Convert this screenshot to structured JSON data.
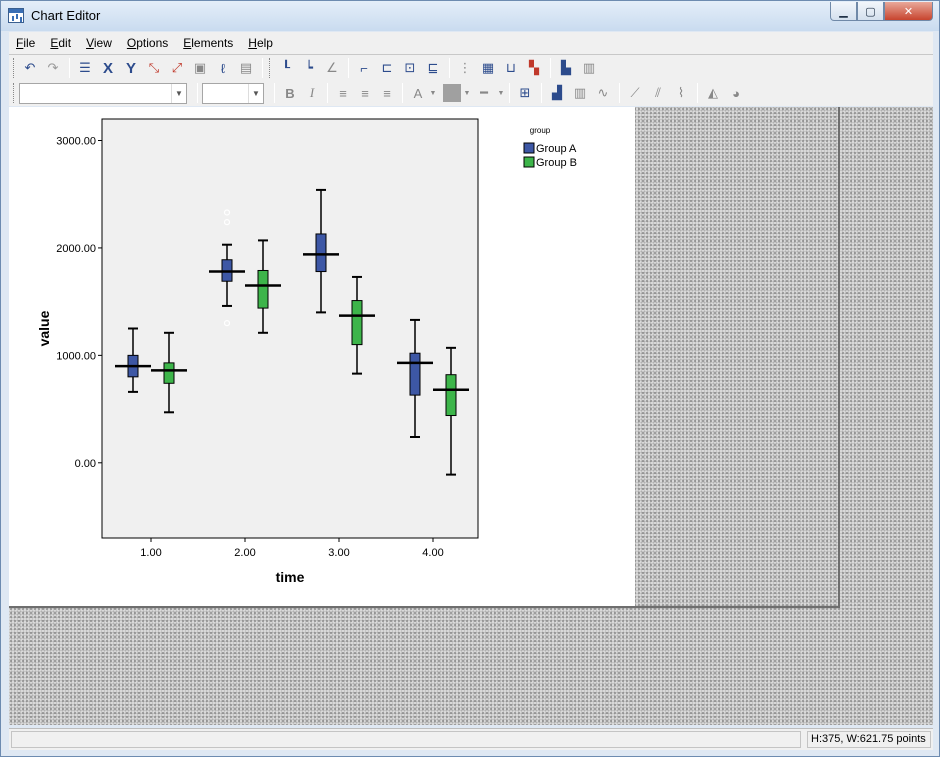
{
  "window": {
    "title": "Chart Editor",
    "title_icon": "chart-editor-app-icon"
  },
  "menu": [
    {
      "label": "File",
      "u": "F",
      "rest": "ile"
    },
    {
      "label": "Edit",
      "u": "E",
      "rest": "dit"
    },
    {
      "label": "View",
      "u": "V",
      "rest": "iew"
    },
    {
      "label": "Options",
      "u": "O",
      "rest": "ptions"
    },
    {
      "label": "Elements",
      "u": "E",
      "rest": "lements"
    },
    {
      "label": "Help",
      "u": "H",
      "rest": "elp"
    }
  ],
  "toolbar": {
    "font_combo_value": "",
    "size_combo_value": "",
    "bold_label": "B",
    "italic_label": "I",
    "text_color_label": "A"
  },
  "chart_data": {
    "type": "boxplot",
    "title": "",
    "xlabel": "time",
    "ylabel": "value",
    "ylim": [
      -700,
      3200
    ],
    "yticks": [
      "0.00",
      "1000.00",
      "2000.00",
      "3000.00"
    ],
    "ytick_values": [
      0,
      1000,
      2000,
      3000
    ],
    "categories": [
      "1.00",
      "2.00",
      "3.00",
      "4.00"
    ],
    "legend": {
      "title": "group",
      "position": "top-right",
      "items": [
        "Group A",
        "Group B"
      ]
    },
    "colors": {
      "Group A": "#3d57a5",
      "Group B": "#3db54a"
    },
    "plot_background": "#f0f0f0",
    "series": [
      {
        "name": "Group A",
        "boxes": [
          {
            "category": "1.00",
            "min": 660,
            "q1": 800,
            "median": 900,
            "q3": 1000,
            "max": 1250,
            "outliers": []
          },
          {
            "category": "2.00",
            "min": 1460,
            "q1": 1690,
            "median": 1780,
            "q3": 1890,
            "max": 2030,
            "outliers": [
              2330,
              2240,
              1300
            ]
          },
          {
            "category": "3.00",
            "min": 1400,
            "q1": 1780,
            "median": 1940,
            "q3": 2130,
            "max": 2540,
            "outliers": []
          },
          {
            "category": "4.00",
            "min": 240,
            "q1": 630,
            "median": 930,
            "q3": 1020,
            "max": 1330,
            "outliers": []
          }
        ]
      },
      {
        "name": "Group B",
        "boxes": [
          {
            "category": "1.00",
            "min": 470,
            "q1": 740,
            "median": 860,
            "q3": 930,
            "max": 1210,
            "outliers": []
          },
          {
            "category": "2.00",
            "min": 1210,
            "q1": 1440,
            "median": 1650,
            "q3": 1790,
            "max": 2070,
            "outliers": []
          },
          {
            "category": "3.00",
            "min": 830,
            "q1": 1100,
            "median": 1370,
            "q3": 1510,
            "max": 1730,
            "outliers": []
          },
          {
            "category": "4.00",
            "min": -110,
            "q1": 440,
            "median": 680,
            "q3": 820,
            "max": 1070,
            "outliers": []
          }
        ]
      }
    ]
  },
  "status": {
    "left_text": "",
    "dimensions": "H:375, W:621.75 points"
  }
}
